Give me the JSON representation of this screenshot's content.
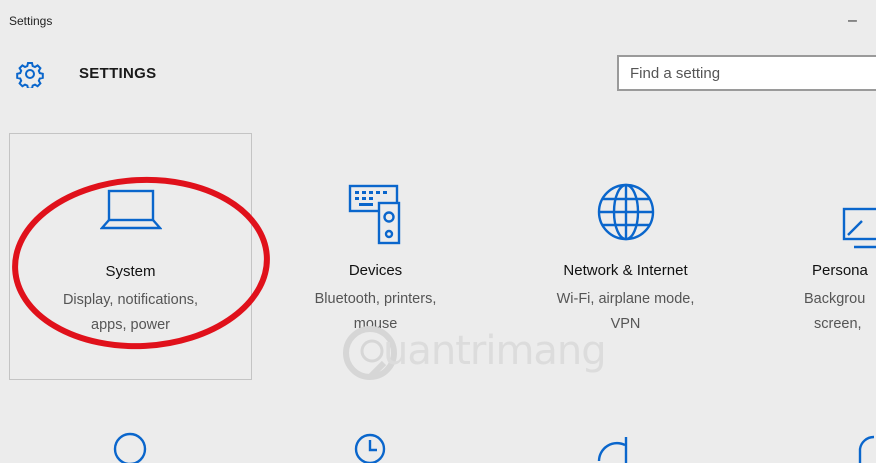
{
  "window": {
    "title": "Settings",
    "minimize_glyph": "–"
  },
  "header": {
    "title": "SETTINGS",
    "icon": "gear-icon"
  },
  "search": {
    "placeholder": "Find a setting"
  },
  "tiles": [
    {
      "name": "System",
      "desc_line1": "Display, notifications,",
      "desc_line2": "apps, power",
      "icon": "laptop-icon"
    },
    {
      "name": "Devices",
      "desc_line1": "Bluetooth, printers,",
      "desc_line2": "mouse",
      "icon": "devices-icon"
    },
    {
      "name": "Network & Internet",
      "desc_line1": "Wi-Fi, airplane mode,",
      "desc_line2": "VPN",
      "icon": "globe-icon"
    },
    {
      "name": "Persona",
      "desc_line1": "Backgrou",
      "desc_line2": "screen,",
      "icon": "personalization-icon"
    }
  ],
  "watermark": {
    "text": "uantrimang"
  },
  "colors": {
    "accent": "#0a66cc",
    "highlight": "#e0111b",
    "background": "#ececec"
  }
}
